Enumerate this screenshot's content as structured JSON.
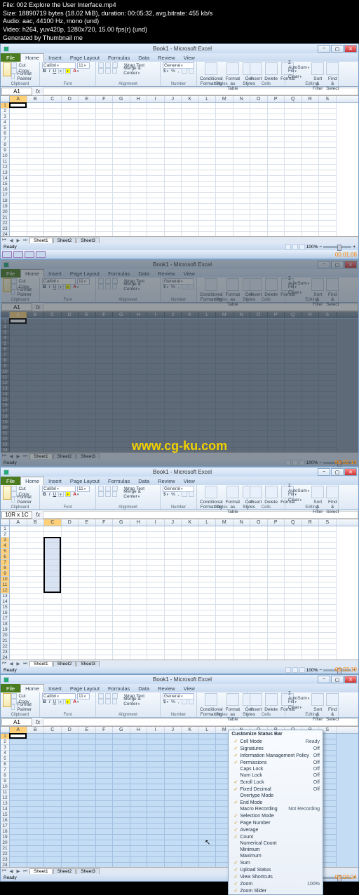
{
  "meta": {
    "file": "File: 002 Explore the User Interface.mp4",
    "size": "Size: 18890719 bytes (18.02 MiB), duration: 00:05:32, avg.bitrate: 455 kb/s",
    "audio": "Audio: aac, 44100 Hz, mono (und)",
    "video": "Video: h264, yuv420p, 1280x720, 15.00 fps(r) (und)",
    "gen": "Generated by Thumbnail me"
  },
  "excel": {
    "title": "Book1 - Microsoft Excel",
    "tabs": {
      "file": "File",
      "home": "Home",
      "insert": "Insert",
      "pagelayout": "Page Layout",
      "formulas": "Formulas",
      "data": "Data",
      "review": "Review",
      "view": "View"
    },
    "clipboard": {
      "paste": "Paste",
      "cut": "Cut",
      "copy": "Copy",
      "formatpainter": "Format Painter",
      "label": "Clipboard"
    },
    "font": {
      "name": "Calibri",
      "size": "11",
      "label": "Font"
    },
    "alignment": {
      "wraptext": "Wrap Text",
      "merge": "Merge & Center",
      "label": "Alignment"
    },
    "number": {
      "format": "General",
      "label": "Number"
    },
    "styles": {
      "conditional": "Conditional Formatting",
      "formatastable": "Format as Table",
      "cellstyles": "Cell Styles",
      "label": "Styles"
    },
    "cells": {
      "insert": "Insert",
      "delete": "Delete",
      "format": "Format",
      "label": "Cells"
    },
    "editing": {
      "autosum": "AutoSum",
      "fill": "Fill",
      "clear": "Clear",
      "sortfilter": "Sort & Filter",
      "findselect": "Find & Select",
      "label": "Editing"
    },
    "namebox1": "A1",
    "namebox3": "10R x 1C",
    "sheets": {
      "s1": "Sheet1",
      "s2": "Sheet2",
      "s3": "Sheet3"
    },
    "status": {
      "ready": "Ready",
      "zoom": "100%"
    }
  },
  "cols": [
    "A",
    "B",
    "C",
    "D",
    "E",
    "F",
    "G",
    "H",
    "I",
    "J",
    "K",
    "L",
    "M",
    "N",
    "O",
    "P",
    "Q",
    "R",
    "S"
  ],
  "watermark": "www.cg-ku.com",
  "timestamps": {
    "t1": "00:01:08",
    "t2": "00:02:14",
    "t3": "00:03:19",
    "t4": "00:04:24"
  },
  "statusbar_menu": {
    "title": "Customize Status Bar",
    "items": [
      {
        "chk": true,
        "label": "Cell Mode",
        "status": "Ready"
      },
      {
        "chk": true,
        "label": "Signatures",
        "status": "Off"
      },
      {
        "chk": true,
        "label": "Information Management Policy",
        "status": "Off"
      },
      {
        "chk": true,
        "label": "Permissions",
        "status": "Off"
      },
      {
        "chk": false,
        "label": "Caps Lock",
        "status": "Off"
      },
      {
        "chk": false,
        "label": "Num Lock",
        "status": "Off"
      },
      {
        "chk": true,
        "label": "Scroll Lock",
        "status": "Off"
      },
      {
        "chk": true,
        "label": "Fixed Decimal",
        "status": "Off"
      },
      {
        "chk": false,
        "label": "Overtype Mode",
        "status": ""
      },
      {
        "chk": true,
        "label": "End Mode",
        "status": ""
      },
      {
        "chk": false,
        "label": "Macro Recording",
        "status": "Not Recording"
      },
      {
        "chk": true,
        "label": "Selection Mode",
        "status": ""
      },
      {
        "chk": true,
        "label": "Page Number",
        "status": ""
      },
      {
        "chk": true,
        "label": "Average",
        "status": ""
      },
      {
        "chk": true,
        "label": "Count",
        "status": ""
      },
      {
        "chk": false,
        "label": "Numerical Count",
        "status": ""
      },
      {
        "chk": false,
        "label": "Minimum",
        "status": ""
      },
      {
        "chk": false,
        "label": "Maximum",
        "status": ""
      },
      {
        "chk": true,
        "label": "Sum",
        "status": ""
      },
      {
        "chk": true,
        "label": "Upload Status",
        "status": ""
      },
      {
        "chk": true,
        "label": "View Shortcuts",
        "status": ""
      },
      {
        "chk": true,
        "label": "Zoom",
        "status": "100%"
      },
      {
        "chk": true,
        "label": "Zoom Slider",
        "status": ""
      }
    ]
  }
}
